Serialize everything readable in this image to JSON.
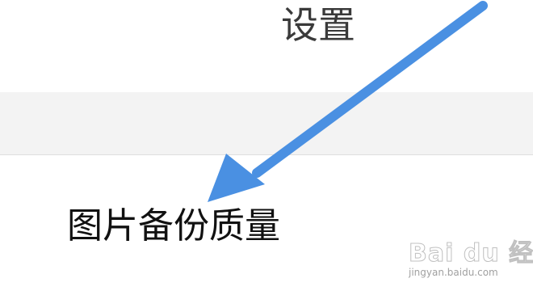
{
  "header": {
    "title": "设置"
  },
  "settings": {
    "image_backup_quality_label": "图片备份质量"
  },
  "annotation": {
    "arrow_color": "#4a90e2"
  },
  "watermark": {
    "logo": "Bai du 经验",
    "sub": "jingyan.baidu.com"
  }
}
